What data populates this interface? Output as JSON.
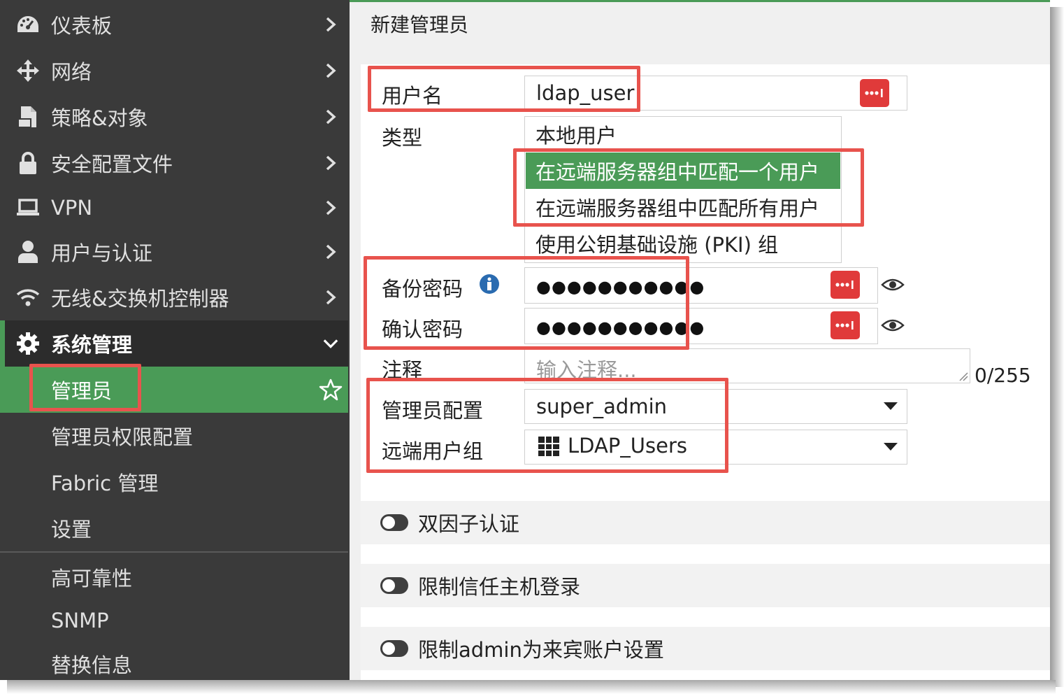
{
  "sidebar": {
    "items": [
      {
        "label": "仪表板",
        "icon": "dashboard-icon"
      },
      {
        "label": "网络",
        "icon": "network-move-icon"
      },
      {
        "label": "策略&对象",
        "icon": "policy-document-icon"
      },
      {
        "label": "安全配置文件",
        "icon": "lock-icon"
      },
      {
        "label": "VPN",
        "icon": "laptop-icon"
      },
      {
        "label": "用户与认证",
        "icon": "user-icon"
      },
      {
        "label": "无线&交换机控制器",
        "icon": "wifi-icon"
      },
      {
        "label": "系统管理",
        "icon": "gear-icon"
      }
    ],
    "subitems": [
      "管理员",
      "管理员权限配置",
      "Fabric 管理",
      "设置",
      "高可靠性",
      "SNMP",
      "替换信息"
    ]
  },
  "page": {
    "title": "新建管理员"
  },
  "form": {
    "username_label": "用户名",
    "username_value": "ldap_user",
    "type_label": "类型",
    "type_options": [
      "本地用户",
      "在远端服务器组中匹配一个用户",
      "在远端服务器组中匹配所有用户",
      "使用公钥基础设施 (PKI) 组"
    ],
    "type_selected": "在远端服务器组中匹配一个用户",
    "backup_password_label": "备份密码",
    "backup_password_value": "●●●●●●●●●●●",
    "confirm_password_label": "确认密码",
    "confirm_password_value": "●●●●●●●●●●●",
    "comment_label": "注释",
    "comment_placeholder": "输入注释...",
    "comment_counter": "0/255",
    "admin_profile_label": "管理员配置",
    "admin_profile_value": "super_admin",
    "remote_group_label": "远端用户组",
    "remote_group_value": "LDAP_Users",
    "toggles": [
      "双因子认证",
      "限制信任主机登录",
      "限制admin为来宾账户设置"
    ]
  },
  "colors": {
    "accent": "#4a9b57",
    "sidebar": "#3a3a3a",
    "annotation": "#e8534d",
    "button_red": "#e03a3a"
  }
}
